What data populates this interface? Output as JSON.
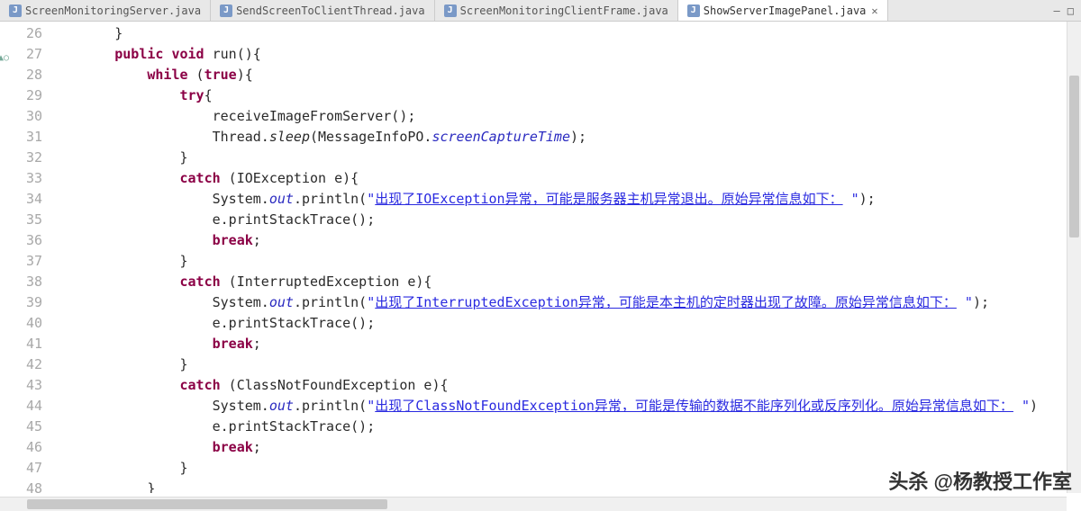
{
  "tabs": [
    {
      "label": "ScreenMonitoringServer.java",
      "active": false
    },
    {
      "label": "SendScreenToClientThread.java",
      "active": false
    },
    {
      "label": "ScreenMonitoringClientFrame.java",
      "active": false
    },
    {
      "label": "ShowServerImagePanel.java",
      "active": true
    }
  ],
  "lineStart": 26,
  "lineEnd": 48,
  "markerLine": 27,
  "code": [
    {
      "indent": 2,
      "tokens": [
        {
          "t": "p",
          "v": "}"
        }
      ]
    },
    {
      "indent": 2,
      "tokens": [
        {
          "t": "kw",
          "v": "public void"
        },
        {
          "t": "p",
          "v": " run(){"
        }
      ]
    },
    {
      "indent": 3,
      "tokens": [
        {
          "t": "kw",
          "v": "while"
        },
        {
          "t": "p",
          "v": " ("
        },
        {
          "t": "kw",
          "v": "true"
        },
        {
          "t": "p",
          "v": "){"
        }
      ]
    },
    {
      "indent": 4,
      "tokens": [
        {
          "t": "kw",
          "v": "try"
        },
        {
          "t": "p",
          "v": "{"
        }
      ]
    },
    {
      "indent": 5,
      "tokens": [
        {
          "t": "p",
          "v": "receiveImageFromServer();"
        }
      ]
    },
    {
      "indent": 5,
      "tokens": [
        {
          "t": "p",
          "v": "Thread."
        },
        {
          "t": "it",
          "v": "sleep"
        },
        {
          "t": "p",
          "v": "(MessageInfoPO."
        },
        {
          "t": "fld",
          "v": "screenCaptureTime"
        },
        {
          "t": "p",
          "v": ");"
        }
      ]
    },
    {
      "indent": 4,
      "tokens": [
        {
          "t": "p",
          "v": "}"
        }
      ]
    },
    {
      "indent": 4,
      "tokens": [
        {
          "t": "kw",
          "v": "catch"
        },
        {
          "t": "p",
          "v": " (IOException e){"
        }
      ]
    },
    {
      "indent": 5,
      "tokens": [
        {
          "t": "p",
          "v": "System."
        },
        {
          "t": "fld",
          "v": "out"
        },
        {
          "t": "p",
          "v": ".println("
        },
        {
          "t": "str",
          "v": "\""
        },
        {
          "t": "strb",
          "v": "出现了IOException异常，可能是服务器主机异常退出。原始异常信息如下："
        },
        {
          "t": "str",
          "v": " \""
        },
        {
          "t": "p",
          "v": ");"
        }
      ]
    },
    {
      "indent": 5,
      "tokens": [
        {
          "t": "p",
          "v": "e.printStackTrace();"
        }
      ]
    },
    {
      "indent": 5,
      "tokens": [
        {
          "t": "kw",
          "v": "break"
        },
        {
          "t": "p",
          "v": ";"
        }
      ]
    },
    {
      "indent": 4,
      "tokens": [
        {
          "t": "p",
          "v": "}"
        }
      ]
    },
    {
      "indent": 4,
      "tokens": [
        {
          "t": "kw",
          "v": "catch"
        },
        {
          "t": "p",
          "v": " (InterruptedException e){"
        }
      ]
    },
    {
      "indent": 5,
      "tokens": [
        {
          "t": "p",
          "v": "System."
        },
        {
          "t": "fld",
          "v": "out"
        },
        {
          "t": "p",
          "v": ".println("
        },
        {
          "t": "str",
          "v": "\""
        },
        {
          "t": "strb",
          "v": "出现了InterruptedException异常，可能是本主机的定时器出现了故障。原始异常信息如下："
        },
        {
          "t": "str",
          "v": " \""
        },
        {
          "t": "p",
          "v": ");"
        }
      ]
    },
    {
      "indent": 5,
      "tokens": [
        {
          "t": "p",
          "v": "e.printStackTrace();"
        }
      ]
    },
    {
      "indent": 5,
      "tokens": [
        {
          "t": "kw",
          "v": "break"
        },
        {
          "t": "p",
          "v": ";"
        }
      ]
    },
    {
      "indent": 4,
      "tokens": [
        {
          "t": "p",
          "v": "}"
        }
      ]
    },
    {
      "indent": 4,
      "tokens": [
        {
          "t": "kw",
          "v": "catch"
        },
        {
          "t": "p",
          "v": " (ClassNotFoundException e){"
        }
      ]
    },
    {
      "indent": 5,
      "tokens": [
        {
          "t": "p",
          "v": "System."
        },
        {
          "t": "fld",
          "v": "out"
        },
        {
          "t": "p",
          "v": ".println("
        },
        {
          "t": "str",
          "v": "\""
        },
        {
          "t": "strb",
          "v": "出现了ClassNotFoundException异常，可能是传输的数据不能序列化或反序列化。原始异常信息如下："
        },
        {
          "t": "str",
          "v": " \""
        },
        {
          "t": "p",
          "v": ")"
        }
      ]
    },
    {
      "indent": 5,
      "tokens": [
        {
          "t": "p",
          "v": "e.printStackTrace();"
        }
      ]
    },
    {
      "indent": 5,
      "tokens": [
        {
          "t": "kw",
          "v": "break"
        },
        {
          "t": "p",
          "v": ";"
        }
      ]
    },
    {
      "indent": 4,
      "tokens": [
        {
          "t": "p",
          "v": "}"
        }
      ]
    },
    {
      "indent": 3,
      "tokens": [
        {
          "t": "p",
          "v": "}"
        }
      ]
    }
  ],
  "watermark": "头杀 @杨教授工作室",
  "windowControls": {
    "minimize": "—",
    "close": "□"
  }
}
